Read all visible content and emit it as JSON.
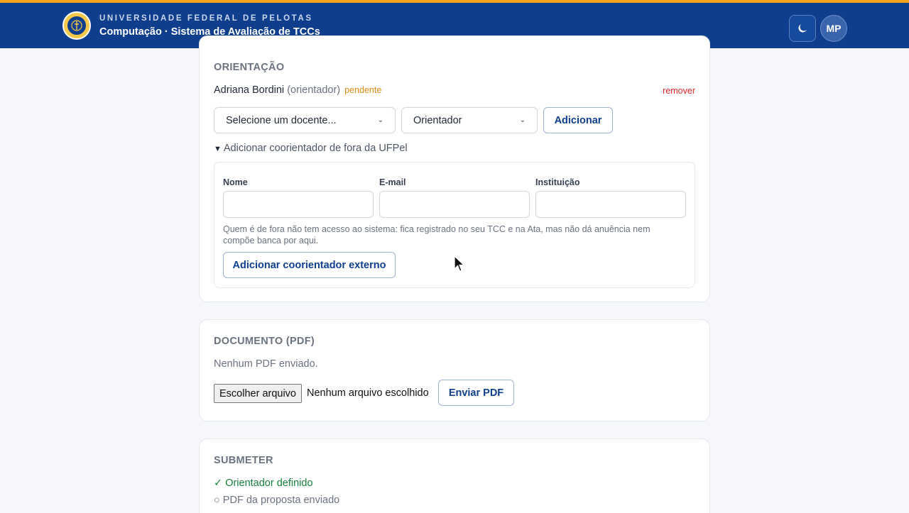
{
  "header": {
    "university": "UNIVERSIDADE FEDERAL DE PELOTAS",
    "system": "Computação · Sistema de Avaliação de TCCs",
    "avatar_initials": "MP",
    "colors": {
      "bar": "#0f3f8c",
      "accent": "#f5a31a"
    }
  },
  "orientation": {
    "title": "ORIENTAÇÃO",
    "advisor": {
      "name": "Adriana Bordini",
      "role": "(orientador)",
      "status": "pendente"
    },
    "remove_label": "remover",
    "teacher_select": "Selecione um docente...",
    "role_select": "Orientador",
    "add_button": "Adicionar",
    "external_summary": "Adicionar coorientador de fora da UFPel",
    "fields": {
      "name_label": "Nome",
      "email_label": "E-mail",
      "institution_label": "Instituição"
    },
    "hint": "Quem é de fora não tem acesso ao sistema: fica registrado no seu TCC e na Ata, mas não dá anuência nem compõe banca por aqui.",
    "external_button": "Adicionar coorientador externo"
  },
  "document": {
    "title": "DOCUMENTO (PDF)",
    "status": "Nenhum PDF enviado.",
    "choose_file": "Escolher arquivo",
    "no_file": "Nenhum arquivo escolhido",
    "send_button": "Enviar PDF"
  },
  "submit": {
    "title": "SUBMETER",
    "checks": [
      {
        "icon": "✓",
        "label": "Orientador definido",
        "done": true
      },
      {
        "icon": "○",
        "label": "PDF da proposta enviado",
        "done": false
      }
    ]
  }
}
